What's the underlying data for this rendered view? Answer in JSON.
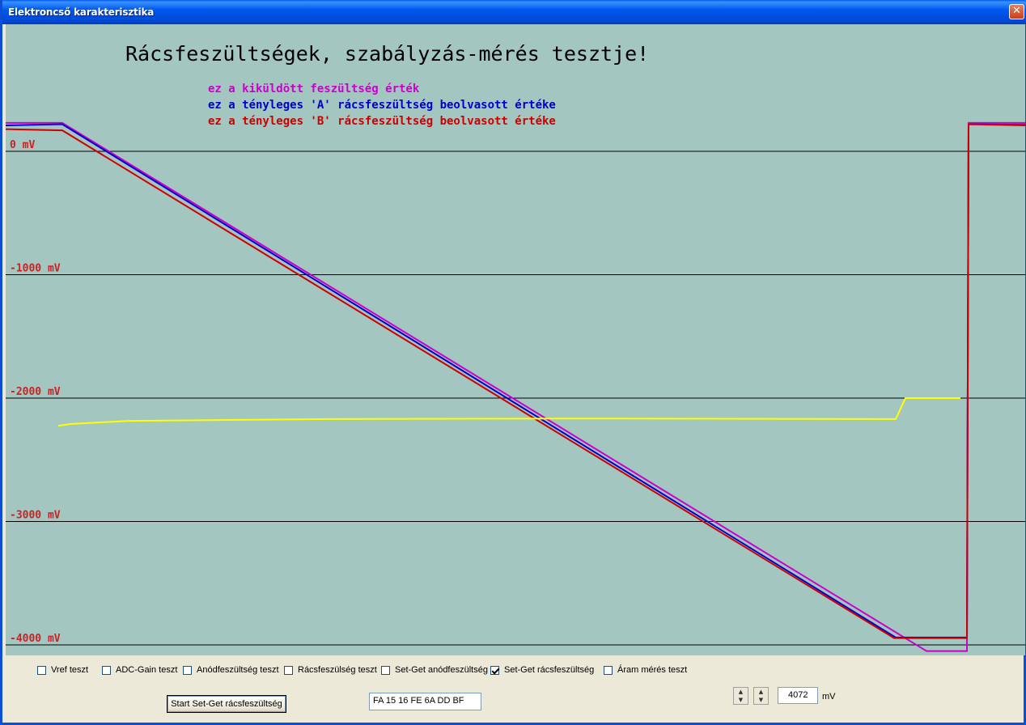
{
  "window": {
    "title": "Elektroncső karakterisztika",
    "close_glyph": "✕"
  },
  "plot": {
    "title": "Rácsfeszültségek, szabályzás-mérés tesztje!",
    "legend": [
      {
        "text": "ez a kiküldött feszültség érték",
        "color": "#cc00cc"
      },
      {
        "text": "ez a tényleges 'A' rácsfeszültség beolvasott  értéke",
        "color": "#0000cc"
      },
      {
        "text": "ez a tényleges 'B' rácsfeszültség beolvasott  értéke",
        "color": "#cc0000"
      }
    ],
    "background": "#a3c6c0",
    "y_labels": [
      "0  mV",
      "-1000  mV",
      "-2000  mV",
      "-3000  mV",
      "-4000  mV"
    ]
  },
  "chart_data": {
    "type": "line",
    "ylabel": "",
    "ylim": [
      -4130,
      230
    ],
    "grid": true,
    "y_ticks": [
      0,
      -1000,
      -2000,
      -3000,
      -4000
    ],
    "series": [
      {
        "color": "#cc00cc",
        "x": [
          0,
          70,
          1138,
          1185,
          1188,
          1190,
          1260
        ],
        "y": [
          230,
          230,
          -4050,
          -4050,
          -4050,
          230,
          230
        ]
      },
      {
        "color": "#0000cc",
        "x": [
          0,
          70,
          1100,
          1185,
          1188,
          1190,
          1260
        ],
        "y": [
          210,
          220,
          -3940,
          -3940,
          -3940,
          220,
          215
        ]
      },
      {
        "color": "#cc0000",
        "x": [
          0,
          70,
          1098,
          1185,
          1188,
          1190,
          1260
        ],
        "y": [
          180,
          170,
          -3945,
          -3945,
          -3945,
          220,
          210
        ]
      },
      {
        "color": "#ffff00",
        "x": [
          65,
          80,
          150,
          400,
          700,
          1100,
          1112,
          1180
        ],
        "y": [
          -2225,
          -2210,
          -2185,
          -2170,
          -2165,
          -2170,
          -2000,
          -2000
        ]
      }
    ]
  },
  "checkboxes": [
    {
      "label": "Vref teszt",
      "checked": false
    },
    {
      "label": "ADC-Gain teszt",
      "checked": false
    },
    {
      "label": "Anódfeszültség teszt",
      "checked": false
    },
    {
      "label": "Rácsfeszülség teszt",
      "checked": false
    },
    {
      "label": "Set-Get anódfeszültség",
      "checked": false
    },
    {
      "label": "Set-Get rácsfeszültség",
      "checked": true
    },
    {
      "label": "Áram mérés teszt",
      "checked": false
    }
  ],
  "start_button": "Start Set-Get rácsfeszültség",
  "hex_field": "FA  15 16 FE 6A DD BF",
  "value_field": "4072",
  "value_unit": "mV",
  "spin_up": "▲",
  "spin_down": "▼"
}
